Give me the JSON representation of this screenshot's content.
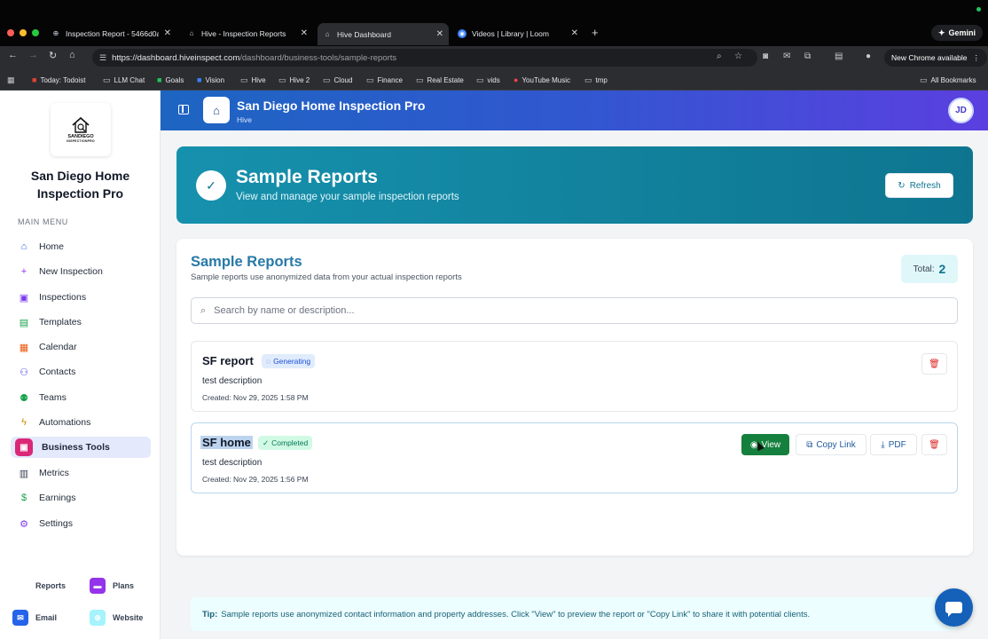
{
  "browser": {
    "tabs": [
      {
        "title": "Inspection Report - 5466d0a",
        "active": false,
        "icon": "globe-icon"
      },
      {
        "title": "Hive - Inspection Reports",
        "active": false,
        "icon": "hive-icon"
      },
      {
        "title": "Hive Dashboard",
        "active": true,
        "icon": "hive-icon"
      },
      {
        "title": "Videos | Library | Loom",
        "active": false,
        "icon": "loom-icon"
      }
    ],
    "gemini_label": "Gemini",
    "url_host": "https://dashboard.hiveinspect.com",
    "url_path": "/dashboard/business-tools/sample-reports",
    "new_chrome_label": "New Chrome available",
    "bookmarks": [
      {
        "label": "Today: Todoist",
        "icon": "todoist-icon"
      },
      {
        "label": "LLM Chat",
        "icon": "folder-icon"
      },
      {
        "label": "Goals",
        "icon": "sheets-icon"
      },
      {
        "label": "Vision",
        "icon": "docs-icon"
      },
      {
        "label": "Hive",
        "icon": "folder-icon"
      },
      {
        "label": "Hive 2",
        "icon": "folder-icon"
      },
      {
        "label": "Cloud",
        "icon": "folder-icon"
      },
      {
        "label": "Finance",
        "icon": "folder-icon"
      },
      {
        "label": "Real Estate",
        "icon": "folder-icon"
      },
      {
        "label": "vids",
        "icon": "folder-icon"
      },
      {
        "label": "YouTube Music",
        "icon": "youtube-music-icon"
      },
      {
        "label": "tmp",
        "icon": "folder-icon"
      }
    ],
    "all_bookmarks_label": "All Bookmarks"
  },
  "sidebar": {
    "logo_text_line1": "SANDIEGO",
    "logo_text_line2": "INSPECTIONPRO",
    "company_name": "San Diego Home Inspection Pro",
    "menu_label": "MAIN MENU",
    "items": [
      {
        "label": "Home",
        "icon": "home-icon",
        "color": "#2563eb",
        "active": false
      },
      {
        "label": "New Inspection",
        "icon": "plus-icon",
        "color": "#9333ea",
        "active": false
      },
      {
        "label": "Inspections",
        "icon": "clipboard-icon",
        "color": "#7c3aed",
        "active": false
      },
      {
        "label": "Templates",
        "icon": "document-icon",
        "color": "#16a34a",
        "active": false
      },
      {
        "label": "Calendar",
        "icon": "calendar-icon",
        "color": "#ea580c",
        "active": false
      },
      {
        "label": "Contacts",
        "icon": "users-icon",
        "color": "#4f46e5",
        "active": false
      },
      {
        "label": "Teams",
        "icon": "team-icon",
        "color": "#16a34a",
        "active": false
      },
      {
        "label": "Automations",
        "icon": "bolt-icon",
        "color": "#ca8a04",
        "active": false
      },
      {
        "label": "Business Tools",
        "icon": "briefcase-icon",
        "color": "#db2777",
        "active": true
      },
      {
        "label": "Metrics",
        "icon": "bar-chart-icon",
        "color": "#374151",
        "active": false
      },
      {
        "label": "Earnings",
        "icon": "dollar-icon",
        "color": "#16a34a",
        "active": false
      },
      {
        "label": "Settings",
        "icon": "gear-icon",
        "color": "#7c3aed",
        "active": false
      }
    ],
    "footer": [
      {
        "label": "Reports",
        "icon": "reports-icon",
        "color": "#ffffff"
      },
      {
        "label": "Plans",
        "icon": "plans-icon",
        "color": "#9333ea"
      },
      {
        "label": "Email",
        "icon": "mail-icon",
        "color": "#2563eb"
      },
      {
        "label": "Website",
        "icon": "globe-icon",
        "color": "#67e8f9"
      }
    ]
  },
  "header": {
    "title": "San Diego Home Inspection Pro",
    "subtitle": "Hive",
    "avatar_initials": "JD"
  },
  "hero": {
    "title": "Sample Reports",
    "subtitle": "View and manage your sample inspection reports",
    "refresh_label": "Refresh"
  },
  "panel": {
    "title": "Sample Reports",
    "subtitle": "Sample reports use anonymized data from your actual inspection reports",
    "total_label": "Total:",
    "total_value": "2",
    "search_placeholder": "Search by name or description...",
    "search_value": ""
  },
  "reports": [
    {
      "name": "SF report",
      "status": "Generating",
      "description": "test description",
      "created": "Created: Nov 29, 2025 1:58 PM"
    },
    {
      "name": "SF home",
      "status": "Completed",
      "description": "test description",
      "created": "Created: Nov 29, 2025 1:56 PM",
      "actions": {
        "view": "View",
        "copy_link": "Copy Link",
        "pdf": "PDF"
      }
    }
  ],
  "tip": {
    "label": "Tip:",
    "text": "Sample reports use anonymized contact information and property addresses. Click \"View\" to preview the report or \"Copy Link\" to share it with potential clients."
  },
  "colors": {
    "header_gradient_start": "#1d65c1",
    "header_gradient_end": "#5b3fe0",
    "hero_teal": "#0e7590",
    "view_green": "#15803d",
    "delete_red": "#dc2626"
  }
}
